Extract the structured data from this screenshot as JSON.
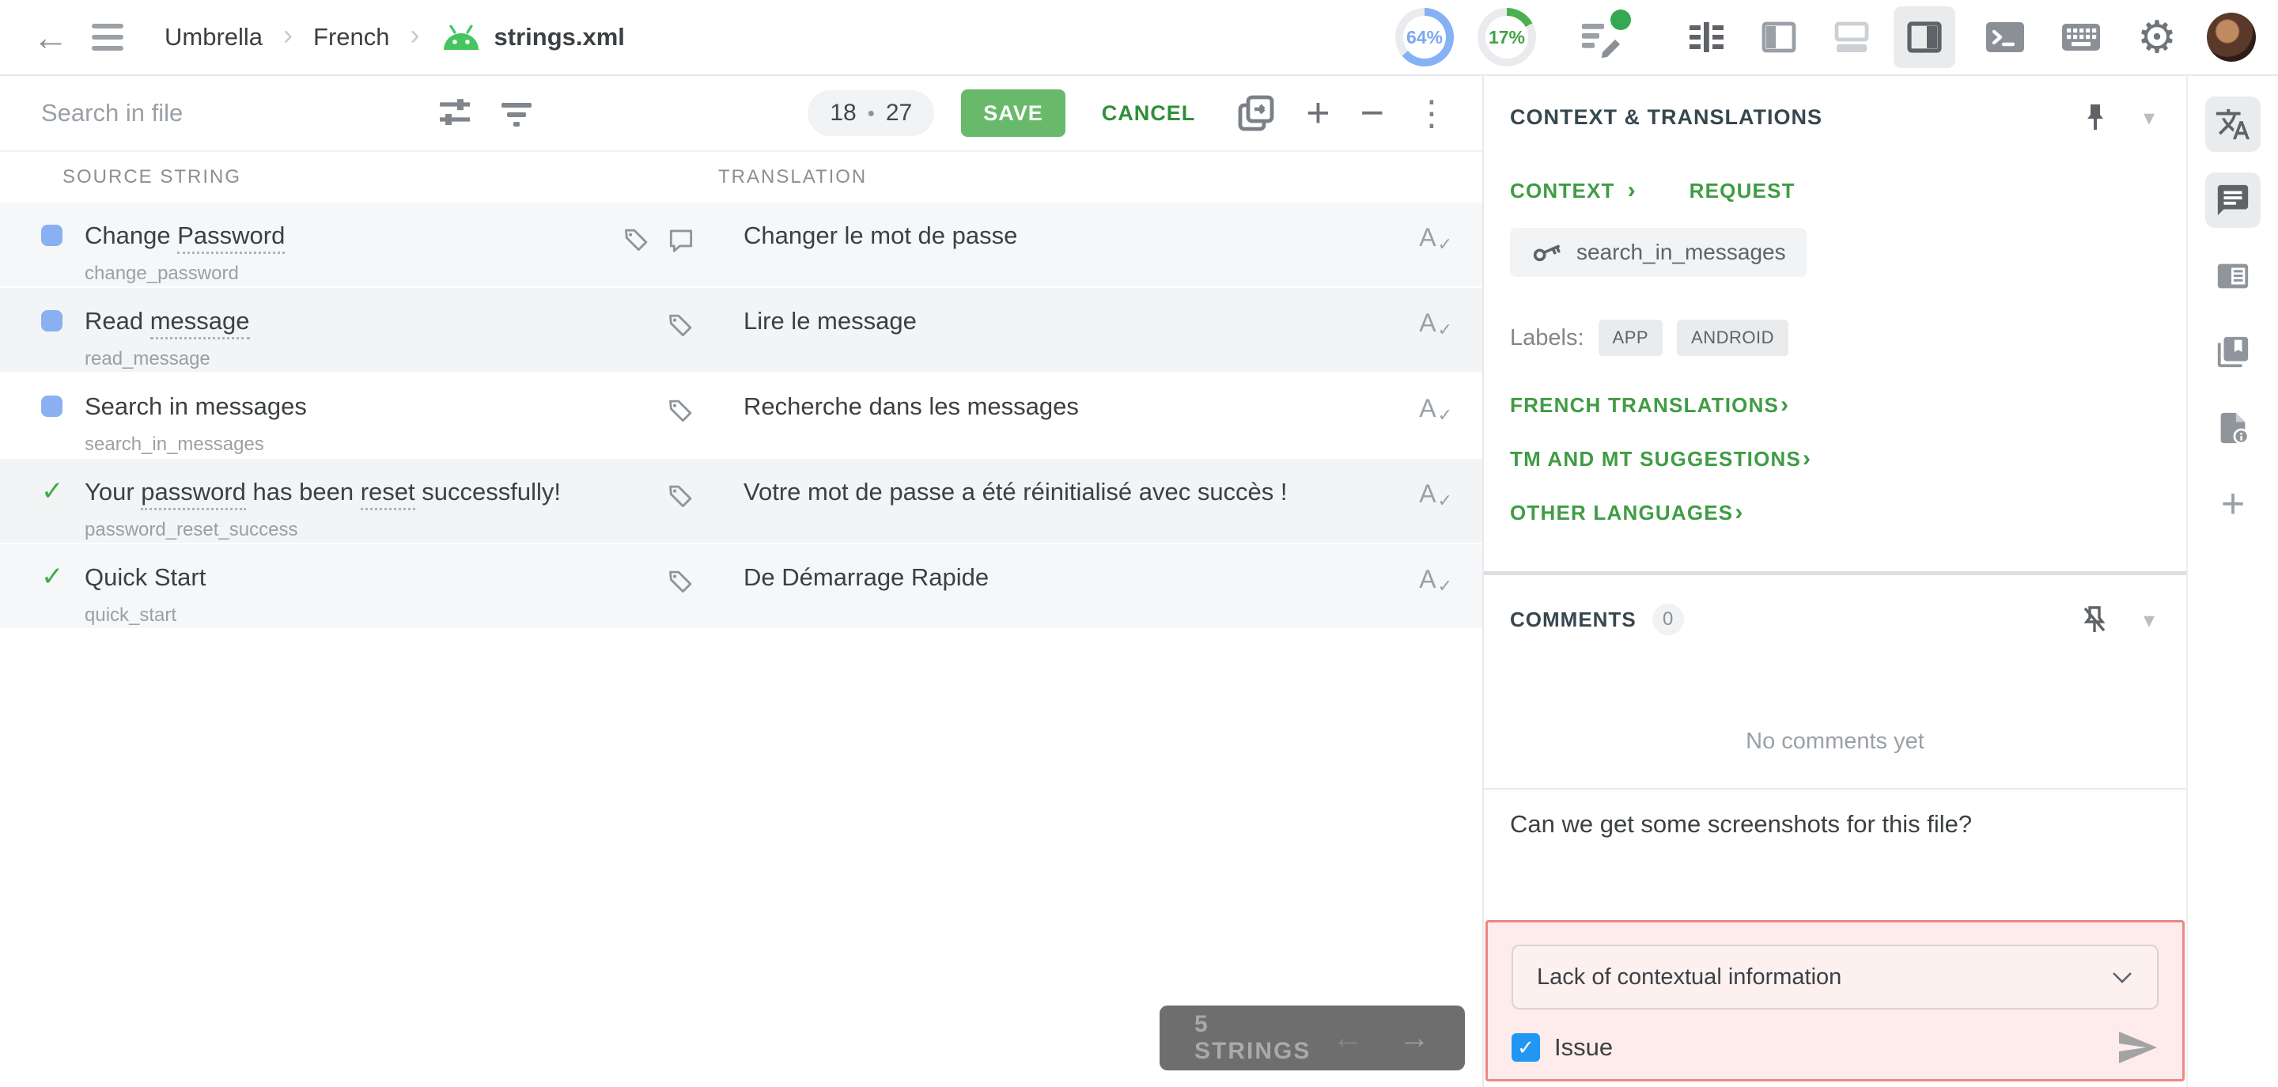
{
  "colors": {
    "accent_green": "#3f9c44",
    "save_green": "#68ba6a",
    "cancel_green": "#2f8f38",
    "progress_blue": "#7aa7f2",
    "status_blue": "#8ab0f2",
    "approved_green": "#3fae49",
    "issue_border_red": "#ee8684",
    "issue_bg_pink": "#fdeceb",
    "checkbox_blue": "#2196f3",
    "android_green": "#44c55f"
  },
  "icons": {
    "back": "←",
    "chevron": "›",
    "chevron_down": "▾",
    "plus": "+",
    "minus": "−",
    "kebab": "⋮",
    "gear": "⚙",
    "bullet": "•",
    "arrow_left": "←",
    "arrow_right": "→",
    "check": "✓",
    "spellcheck_letter": "A",
    "spellcheck_check": "✓",
    "rail_plus": "+"
  },
  "topbar": {
    "breadcrumb": {
      "project": "Umbrella",
      "language": "French",
      "file": "strings.xml"
    },
    "progress": {
      "translated": {
        "label": "64%",
        "pct": 64
      },
      "approved": {
        "label": "17%",
        "pct": 17
      }
    }
  },
  "toolbar": {
    "search_placeholder": "Search in file",
    "counter": {
      "current": "18",
      "total": "27"
    },
    "save": "SAVE",
    "cancel": "CANCEL"
  },
  "table": {
    "columns": {
      "source": "SOURCE STRING",
      "translation": "TRANSLATION"
    }
  },
  "rows": [
    {
      "status": "translated",
      "source": {
        "pre": "Change ",
        "term": "Password"
      },
      "key": "change_password",
      "translation": "Changer le mot de passe"
    },
    {
      "status": "translated",
      "source": {
        "pre": "Read ",
        "term": "message"
      },
      "key": "read_message",
      "translation": "Lire le message"
    },
    {
      "status": "translated",
      "source": {
        "pre": "Search in messages"
      },
      "key": "search_in_messages",
      "translation": "Recherche dans les messages",
      "selected": true
    },
    {
      "status": "approved",
      "source": {
        "pre": "Your ",
        "term": "password",
        "mid": " has been ",
        "term2": "reset",
        "post": " successfully!"
      },
      "key": "password_reset_success",
      "translation": "Votre mot de passe a été réinitialisé avec succès !"
    },
    {
      "status": "approved",
      "source": {
        "pre": "Quick Start"
      },
      "key": "quick_start",
      "translation": "De Démarrage Rapide"
    }
  ],
  "pager": {
    "label": "5 STRINGS"
  },
  "context_panel": {
    "title": "CONTEXT & TRANSLATIONS",
    "context_link": "CONTEXT",
    "request_link": "REQUEST",
    "string_key": "search_in_messages",
    "labels_caption": "Labels:",
    "labels": [
      "APP",
      "ANDROID"
    ],
    "sections": {
      "translations": "FRENCH TRANSLATIONS",
      "suggestions": "TM AND MT SUGGESTIONS",
      "other": "OTHER LANGUAGES"
    }
  },
  "comments_panel": {
    "title": "COMMENTS",
    "count": "0",
    "empty_message": "No comments yet",
    "draft_text": "Can we get some screenshots for this file?",
    "issue": {
      "type_selected": "Lack of contextual information",
      "checkbox_label": "Issue",
      "checked": true
    }
  }
}
